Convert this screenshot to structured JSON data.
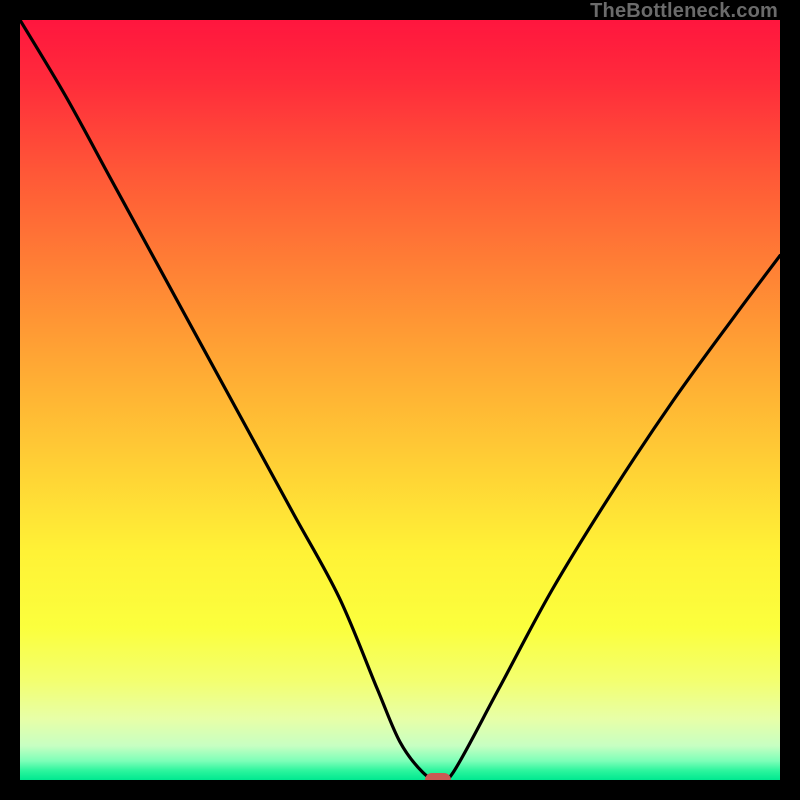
{
  "watermark": "TheBottleneck.com",
  "colors": {
    "frame": "#000000",
    "marker": "#c95a54",
    "curve": "#000000"
  },
  "chart_data": {
    "type": "line",
    "title": "",
    "xlabel": "",
    "ylabel": "",
    "xlim": [
      0,
      100
    ],
    "ylim": [
      0,
      100
    ],
    "grid": false,
    "legend": false,
    "series": [
      {
        "name": "bottleneck-curve",
        "x": [
          0,
          6,
          12,
          18,
          24,
          30,
          36,
          42,
          47,
          50,
          53,
          55,
          57,
          63,
          70,
          78,
          86,
          94,
          100
        ],
        "y": [
          100,
          90,
          79,
          68,
          57,
          46,
          35,
          24,
          12,
          5,
          1,
          0,
          1,
          12,
          25,
          38,
          50,
          61,
          69
        ]
      }
    ],
    "marker": {
      "x": 55,
      "y": 0
    }
  }
}
